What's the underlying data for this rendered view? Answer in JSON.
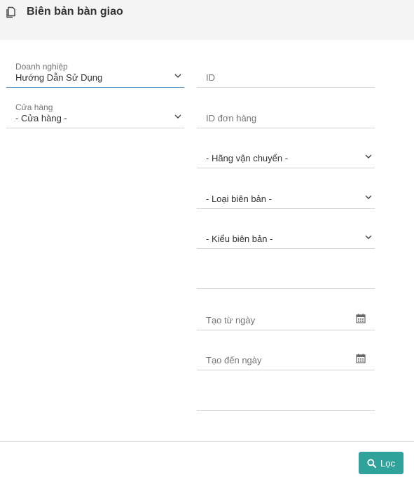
{
  "header": {
    "title": "Biên bản bàn giao",
    "icon": "copy-document-icon"
  },
  "left_column": {
    "business": {
      "label": "Doanh nghiệp",
      "value": "Hướng Dẫn Sử Dụng"
    },
    "store": {
      "label": "Cửa hàng",
      "value": "- Cửa hàng -"
    }
  },
  "right_column": {
    "id_placeholder": "ID",
    "order_id_placeholder": "ID đơn hàng",
    "carrier": "- Hãng vận chuyển -",
    "record_category": "- Loại biên bản -",
    "record_type": "- Kiểu biên bản -",
    "blank_field": "",
    "created_from": "Tạo từ ngày",
    "created_to": "Tạo đến ngày",
    "blank_field_2": ""
  },
  "footer": {
    "filter_label": "Lọc",
    "accent_color": "#2fa39b"
  },
  "colors": {
    "active_underline": "#3c85c5",
    "header_bg": "#f4f4f4"
  }
}
